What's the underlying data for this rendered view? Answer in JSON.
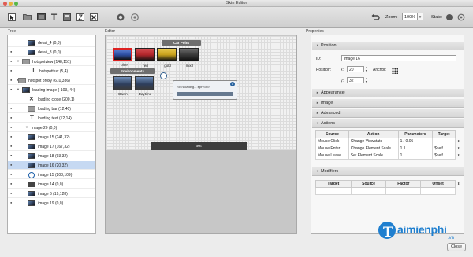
{
  "window": {
    "title": "Skin Editor"
  },
  "toolbar": {
    "zoom_label": "Zoom:",
    "zoom_value": "100%",
    "state_label": "State:"
  },
  "panels": {
    "tree": "Tree",
    "editor": "Editor",
    "properties": "Properties"
  },
  "tree": {
    "rows": [
      {
        "label": "detail_4 (0,0)",
        "icon": "image"
      },
      {
        "label": "detail_8 (0,0)",
        "icon": "image"
      },
      {
        "label": "hotspotview (148,151)",
        "icon": "container"
      },
      {
        "label": "hotspottext (5,4)",
        "icon": "text"
      },
      {
        "label": "hotspot proxy (610,336)",
        "icon": "container"
      },
      {
        "label": "loading image (-103,-44)",
        "icon": "image"
      },
      {
        "label": "loading close (200,1)",
        "icon": "close"
      },
      {
        "label": "loading bar (12,40)",
        "icon": "container"
      },
      {
        "label": "loading text (12,14)",
        "icon": "text"
      },
      {
        "label": "image 20 (0,0)",
        "icon": "none"
      },
      {
        "label": "image 15 (241,32)",
        "icon": "image"
      },
      {
        "label": "image 17 (167,32)",
        "icon": "image"
      },
      {
        "label": "image 18 (93,32)",
        "icon": "image"
      },
      {
        "label": "image 16 (20,32)",
        "icon": "image"
      },
      {
        "label": "image 15 (208,109)",
        "icon": "circle"
      },
      {
        "label": "image 14 (0,0)",
        "icon": "image"
      },
      {
        "label": "image 6 (19,128)",
        "icon": "image"
      },
      {
        "label": "image 19 (0,0)",
        "icon": "image"
      }
    ]
  },
  "editor": {
    "car_point_label": "Car Point",
    "environments_label": "Environments",
    "cars": [
      {
        "label": "blue",
        "color": "#2d4fa3"
      },
      {
        "label": "red",
        "color": "#b3262b"
      },
      {
        "label": "gold",
        "color": "#c9a21c"
      },
      {
        "label": "mix I",
        "color": "#3a3a3a"
      }
    ],
    "envs": [
      {
        "label": "Dawn"
      },
      {
        "label": "Daytime"
      }
    ],
    "loading_text": "<b>Loading... $pH</b>",
    "loading_close": "x",
    "text_bar": "text"
  },
  "properties": {
    "sections": {
      "position": "Position",
      "appearance": "Appearance",
      "image": "Image",
      "advanced": "Advanced",
      "actions": "Actions",
      "modifiers": "Modifiers"
    },
    "id_label": "ID:",
    "id_value": "Image 16",
    "position_label": "Position:",
    "x_label": "x:",
    "x_value": "20",
    "y_label": "y:",
    "y_value": "32",
    "anchor_label": "Anchor:",
    "actions_table": {
      "headers": [
        "Source",
        "Action",
        "Parameters",
        "Target"
      ],
      "rows": [
        [
          "Mouse Click",
          "Change Viewstate",
          "1 / 0.05",
          ""
        ],
        [
          "Mouse Enter",
          "Change Element Scale",
          "1.1",
          "$self"
        ],
        [
          "Mouse Leave",
          "Set Element Scale",
          "1",
          "$self"
        ]
      ]
    },
    "modifiers_table": {
      "headers": [
        "Target",
        "Source",
        "Factor",
        "Offset"
      ]
    }
  },
  "footer": {
    "close_label": "Close"
  },
  "watermark": {
    "text": "aimienphi",
    "letter": "T",
    "suffix": ".vn"
  }
}
